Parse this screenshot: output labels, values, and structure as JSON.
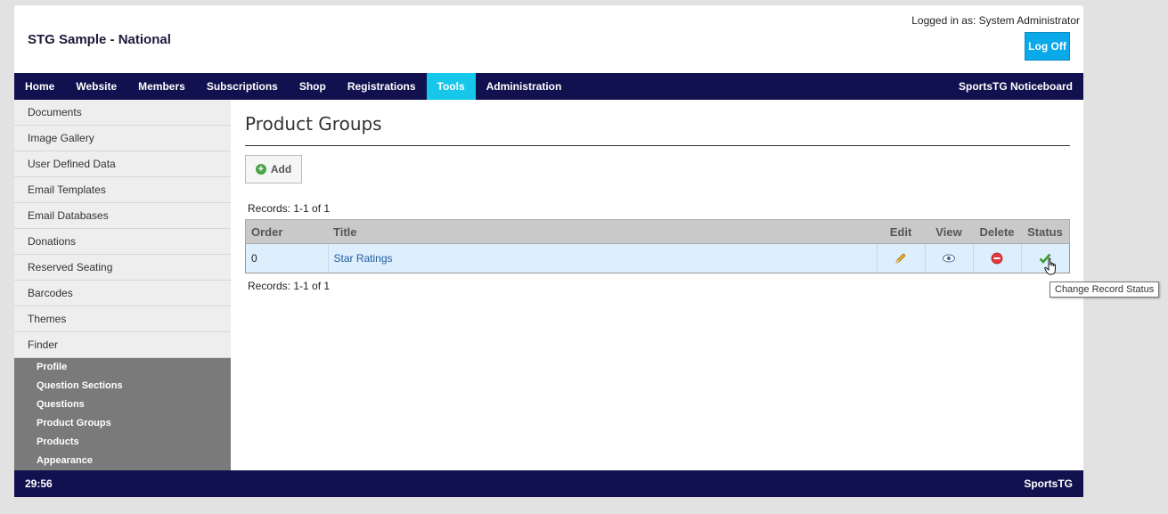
{
  "header": {
    "site_title": "STG Sample - National",
    "login_info": "Logged in as: System Administrator",
    "logoff_label": "Log Off"
  },
  "nav": {
    "items": [
      "Home",
      "Website",
      "Members",
      "Subscriptions",
      "Shop",
      "Registrations",
      "Tools",
      "Administration"
    ],
    "active": "Tools",
    "active_color": "#17c7ea",
    "bar_color": "#11114f",
    "noticeboard": "SportsTG Noticeboard"
  },
  "sidebar": {
    "items": [
      "Documents",
      "Image Gallery",
      "User Defined Data",
      "Email Templates",
      "Email Databases",
      "Donations",
      "Reserved Seating",
      "Barcodes",
      "Themes",
      "Finder"
    ],
    "sub_items": [
      "Profile",
      "Question Sections",
      "Questions",
      "Product Groups",
      "Products",
      "Appearance"
    ]
  },
  "main": {
    "heading": "Product Groups",
    "add_label": "Add",
    "records_top": "Records: 1-1 of 1",
    "records_bottom": "Records: 1-1 of 1",
    "table": {
      "columns": [
        "Order",
        "Title",
        "Edit",
        "View",
        "Delete",
        "Status"
      ],
      "rows": [
        {
          "order": "0",
          "title": "Star Ratings"
        }
      ]
    }
  },
  "tooltip": "Change Record Status",
  "footer": {
    "left": "29:56",
    "right": "SportsTG"
  }
}
